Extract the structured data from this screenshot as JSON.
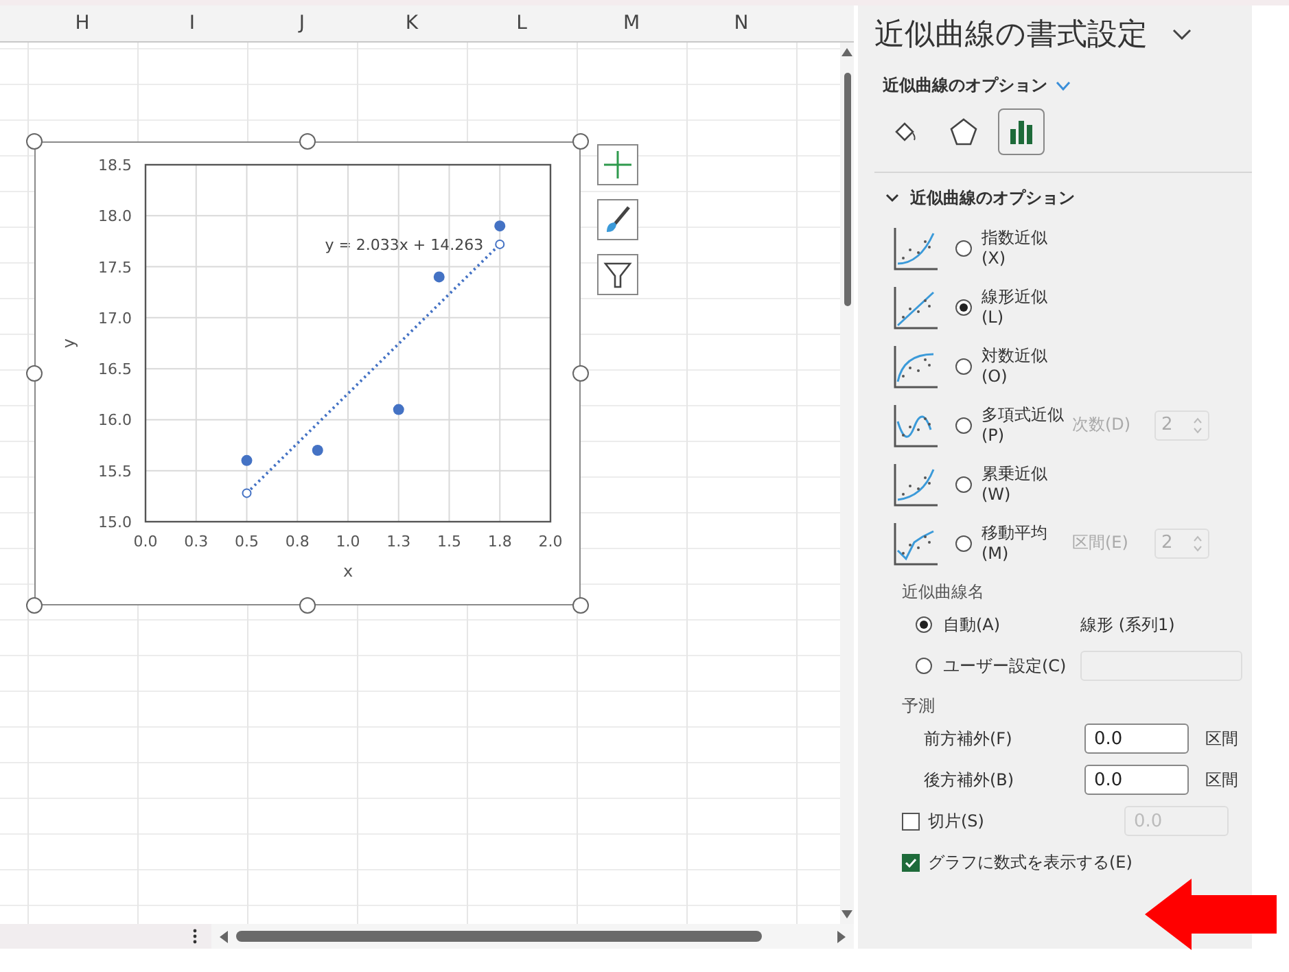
{
  "sheet": {
    "columns": [
      "H",
      "I",
      "J",
      "K",
      "L",
      "M",
      "N"
    ]
  },
  "chart": {
    "chart_data": {
      "type": "scatter",
      "xlabel": "x",
      "ylabel": "y",
      "x": [
        0.5,
        0.85,
        1.25,
        1.45,
        1.75
      ],
      "series": [
        {
          "color": "#4472c4",
          "values": [
            15.6,
            15.7,
            16.1,
            17.4,
            17.9
          ]
        },
        {
          "color": "#4472c4",
          "values": [
            15.28,
            null,
            null,
            null,
            17.72
          ]
        }
      ],
      "xlim": [
        0,
        2
      ],
      "ylim": [
        15,
        18.5
      ],
      "grid": true,
      "xticks": [
        {
          "value": 0,
          "label": "0.0"
        },
        {
          "value": 0.25,
          "label": "0.3"
        },
        {
          "value": 0.5,
          "label": "0.5"
        },
        {
          "value": 0.75,
          "label": "0.8"
        },
        {
          "value": 1,
          "label": "1.0"
        },
        {
          "value": 1.25,
          "label": "1.3"
        },
        {
          "value": 1.5,
          "label": "1.5"
        },
        {
          "value": 1.75,
          "label": "1.8"
        },
        {
          "value": 2,
          "label": "2.0"
        }
      ],
      "yticks": [
        {
          "value": 15,
          "label": "15.0"
        },
        {
          "value": 15.5,
          "label": "15.5"
        },
        {
          "value": 16,
          "label": "16.0"
        },
        {
          "value": 16.5,
          "label": "16.5"
        },
        {
          "value": 17,
          "label": "17.0"
        },
        {
          "value": 17.5,
          "label": "17.5"
        },
        {
          "value": 18,
          "label": "18.0"
        },
        {
          "value": 18.5,
          "label": "18.5"
        }
      ],
      "annotations": [
        "y = 2.033x + 14.263"
      ]
    }
  },
  "panel": {
    "title": "近似曲線の書式設定",
    "subtitle": "近似曲線のオプション",
    "tabs": [
      {
        "kind": "fill",
        "selected": false
      },
      {
        "kind": "effects",
        "selected": false
      },
      {
        "kind": "options",
        "selected": true
      }
    ],
    "section": {
      "title": "近似曲線のオプション",
      "expanded": true
    },
    "trend_types": [
      {
        "kind": "exponential",
        "label": "指数近似(X)",
        "selected": false
      },
      {
        "kind": "linear",
        "label": "線形近似(L)",
        "selected": true
      },
      {
        "kind": "log",
        "label": "対数近似(O)",
        "selected": false
      },
      {
        "kind": "polynomial",
        "label": "多項式近似(P)",
        "selected": false,
        "param_label": "次数(D)",
        "param_value": "2"
      },
      {
        "kind": "power",
        "label": "累乗近似(W)",
        "selected": false
      },
      {
        "kind": "moving",
        "label": "移動平均(M)",
        "selected": false,
        "param_label": "区間(E)",
        "param_value": "2"
      }
    ],
    "name": {
      "label": "近似曲線名",
      "options": [
        {
          "label": "自動(A)",
          "selected": true,
          "value": "線形 (系列1)"
        },
        {
          "label": "ユーザー設定(C)",
          "selected": false
        }
      ]
    },
    "forecast": {
      "label": "予測",
      "rows": [
        {
          "label": "前方補外(F)",
          "value": "0.0",
          "unit": "区間"
        },
        {
          "label": "後方補外(B)",
          "value": "0.0",
          "unit": "区間"
        }
      ]
    },
    "intercept": {
      "label": "切片(S)",
      "checked": false,
      "placeholder": "0.0"
    },
    "show_equation": {
      "label": "グラフに数式を表示する(E)",
      "checked": true
    }
  }
}
